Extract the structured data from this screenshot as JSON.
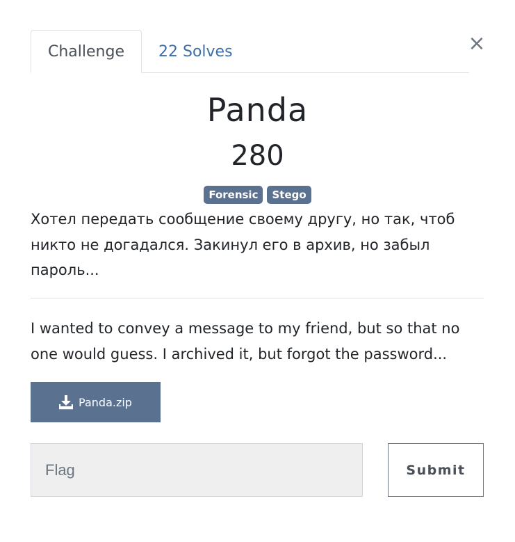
{
  "modal": {
    "close_label": "×",
    "close_icon": "close-icon"
  },
  "tabs": [
    {
      "label": "Challenge",
      "active": true
    },
    {
      "label": "22 Solves",
      "active": false
    }
  ],
  "challenge": {
    "name": "Panda",
    "points": "280",
    "tags": [
      "Forensic",
      "Stego"
    ],
    "description_ru": "Хотел передать сообщение своему другу, но так, чтоб никто не догадался. Закинул его в архив, но забыл пароль...",
    "description_en": "I wanted to convey a message to my friend, but so that no one would guess. I archived it, but forgot the password..."
  },
  "file": {
    "label": "Panda.zip",
    "icon": "download-icon"
  },
  "form": {
    "flag_placeholder": "Flag",
    "flag_value": "",
    "submit_label": "Submit"
  },
  "colors": {
    "accent": "#5a7190",
    "link": "#3e6ea8"
  }
}
